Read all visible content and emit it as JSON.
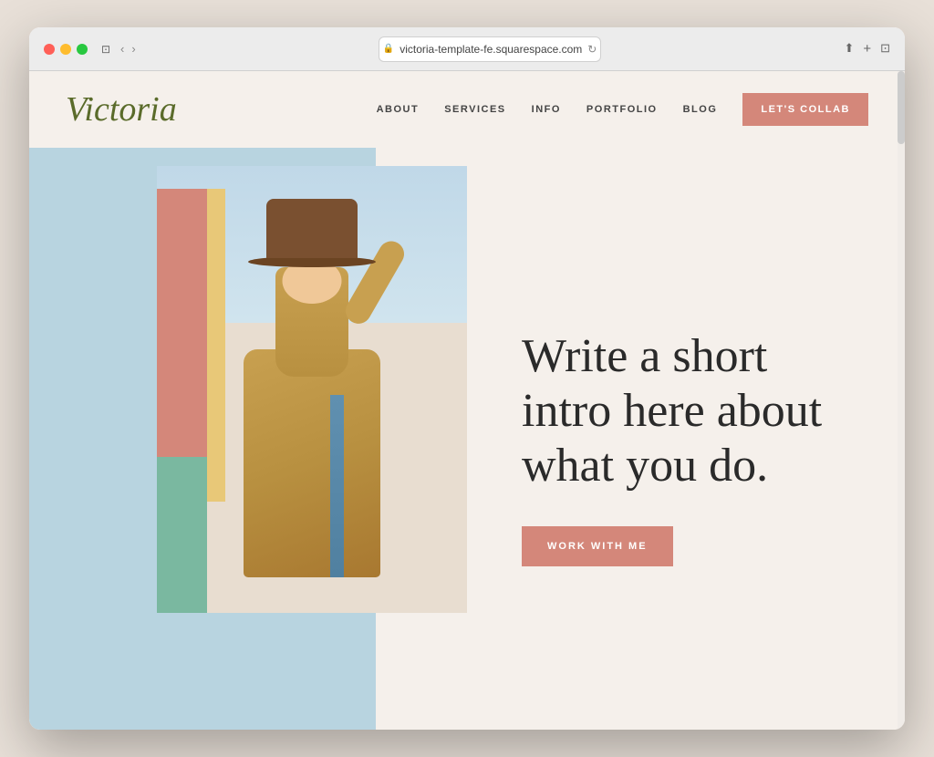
{
  "browser": {
    "url": "victoria-template-fe.squarespace.com",
    "reload_label": "⟳",
    "back_label": "‹",
    "forward_label": "›",
    "share_label": "⬆",
    "new_tab_label": "+",
    "window_label": "⊡"
  },
  "header": {
    "logo": "Victoria",
    "nav": {
      "about": "ABOUT",
      "services": "SERVICES",
      "info": "INFO",
      "portfolio": "PORTFOLIO",
      "blog": "BLOG",
      "cta": "LET'S COLLAB"
    }
  },
  "hero": {
    "headline": "Write a short intro here about what you do.",
    "cta_button": "WORK WITH ME",
    "colors": {
      "brand_pink": "#d4877a",
      "logo_green": "#5a6b2a",
      "bg_cream": "#f5f0eb",
      "sky_blue": "#b8d4e0"
    }
  }
}
